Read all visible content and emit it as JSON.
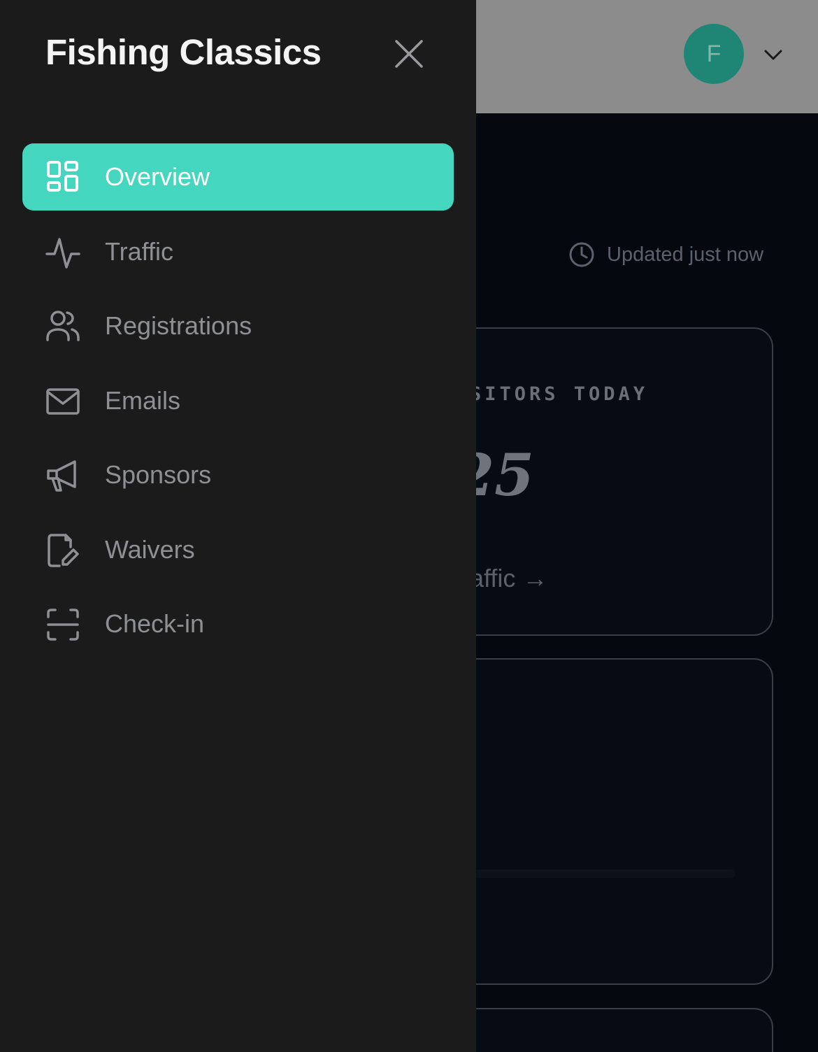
{
  "header": {
    "avatar_initial": "F"
  },
  "status": {
    "updated_text": "Updated just now"
  },
  "visitors_card": {
    "label_partial": "SITORS TODAY",
    "value_partial": "25",
    "link_partial": "raffic →"
  },
  "drawer": {
    "title": "Fishing Classics",
    "nav": [
      {
        "label": "Overview",
        "icon": "grid-icon",
        "active": true
      },
      {
        "label": "Traffic",
        "icon": "activity-icon",
        "active": false
      },
      {
        "label": "Registrations",
        "icon": "users-icon",
        "active": false
      },
      {
        "label": "Emails",
        "icon": "mail-icon",
        "active": false
      },
      {
        "label": "Sponsors",
        "icon": "megaphone-icon",
        "active": false
      },
      {
        "label": "Waivers",
        "icon": "file-edit-icon",
        "active": false
      },
      {
        "label": "Check-in",
        "icon": "scan-icon",
        "active": false
      }
    ]
  },
  "colors": {
    "accent": "#45d6bf",
    "drawer_bg": "#1b1b1c",
    "avatar_bg": "#1f8574"
  }
}
